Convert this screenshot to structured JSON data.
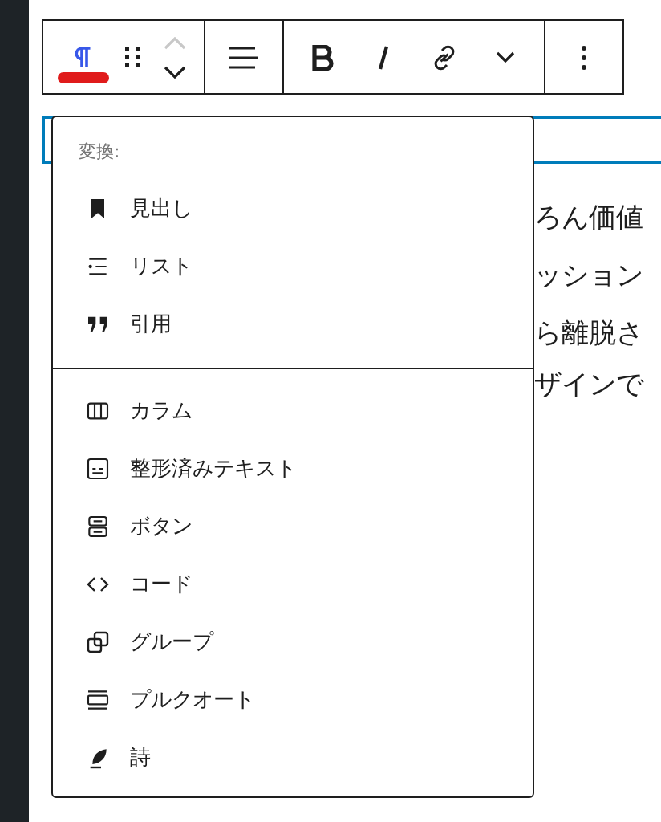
{
  "toolbar": {
    "groups": [
      [
        {
          "kind": "paragraph"
        },
        {
          "kind": "drag"
        },
        {
          "kind": "mover",
          "up_disabled": true,
          "down_disabled": false
        }
      ],
      [
        {
          "kind": "align"
        }
      ],
      [
        {
          "kind": "bold"
        },
        {
          "kind": "italic"
        },
        {
          "kind": "link"
        },
        {
          "kind": "more-rich"
        }
      ],
      [
        {
          "kind": "options"
        }
      ]
    ]
  },
  "transform_menu": {
    "title": "変換:",
    "sections": [
      [
        {
          "label": "見出し",
          "kind": "heading"
        },
        {
          "label": "リスト",
          "kind": "list"
        },
        {
          "label": "引用",
          "kind": "quote"
        }
      ],
      [
        {
          "label": "カラム",
          "kind": "columns"
        },
        {
          "label": "整形済みテキスト",
          "kind": "preformatted"
        },
        {
          "label": "ボタン",
          "kind": "buttons"
        },
        {
          "label": "コード",
          "kind": "code"
        },
        {
          "label": "グループ",
          "kind": "group"
        },
        {
          "label": "プルクオート",
          "kind": "pullquote"
        },
        {
          "label": "詩",
          "kind": "verse"
        }
      ]
    ]
  },
  "paragraph_fragments": [
    "ろん価値",
    "ッション",
    "ら離脱さ",
    "ザインで"
  ]
}
